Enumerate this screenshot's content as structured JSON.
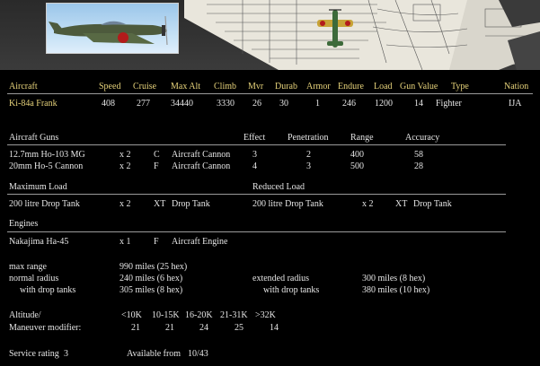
{
  "colors": {
    "header": "#e6d27a",
    "text": "#e6e6e6",
    "background": "#000000",
    "rule": "#9a9a9a"
  },
  "banner": {
    "photo_icon": "aircraft-photo-icon",
    "plane_icon": "aircraft-top-view-icon"
  },
  "summary": {
    "headers": [
      "Aircraft",
      "Speed",
      "Cruise",
      "Max Alt",
      "Climb",
      "Mvr",
      "Durab",
      "Armor",
      "Endure",
      "Load",
      "Gun Value",
      "Type",
      "Nation"
    ],
    "row": {
      "aircraft": "Ki-84a Frank",
      "speed": "408",
      "cruise": "277",
      "max_alt": "34440",
      "climb": "3330",
      "mvr": "26",
      "durab": "30",
      "armor": "1",
      "endure": "246",
      "load": "1200",
      "gun_value": "14",
      "type": "Fighter",
      "nation": "IJA"
    }
  },
  "guns": {
    "title": "Aircraft Guns",
    "headers": {
      "effect": "Effect",
      "penetration": "Penetration",
      "range": "Range",
      "accuracy": "Accuracy"
    },
    "rows": [
      {
        "name": "12.7mm Ho-103 MG",
        "count": "x 2",
        "facing": "C",
        "kind": "Aircraft Cannon",
        "effect": "3",
        "penetration": "2",
        "range": "400",
        "accuracy": "58"
      },
      {
        "name": "20mm Ho-5 Cannon",
        "count": "x 2",
        "facing": "F",
        "kind": "Aircraft Cannon",
        "effect": "4",
        "penetration": "3",
        "range": "500",
        "accuracy": "28"
      }
    ]
  },
  "loads": {
    "max_title": "Maximum Load",
    "reduced_title": "Reduced Load",
    "max": {
      "name": "200 litre Drop Tank",
      "count": "x 2",
      "facing": "XT",
      "kind": "Drop Tank"
    },
    "reduced": {
      "name": "200 litre Drop Tank",
      "count": "x 2",
      "facing": "XT",
      "kind": "Drop Tank"
    }
  },
  "engines": {
    "title": "Engines",
    "row": {
      "name": "Nakajima Ha-45",
      "count": "x 1",
      "facing": "F",
      "kind": "Aircraft Engine"
    }
  },
  "ranges": {
    "max_range_label": "max range",
    "max_range": "990 miles (25 hex)",
    "normal_radius_label": "normal radius",
    "normal_radius": "240 miles (6 hex)",
    "with_drop_tanks_label": "with drop tanks",
    "normal_with_tanks": "305 miles (8 hex)",
    "extended_radius_label": "extended radius",
    "extended_radius": "300 miles (8 hex)",
    "extended_with_drop_tanks_label": "with drop tanks",
    "extended_with_tanks": "380 miles (10 hex)"
  },
  "altitude": {
    "label": "Altitude/",
    "mod_label": "Maneuver modifier:",
    "bands": [
      "<10K",
      "10-15K",
      "16-20K",
      "21-31K",
      ">32K"
    ],
    "modifiers": [
      "21",
      "21",
      "24",
      "25",
      "14"
    ]
  },
  "service": {
    "label": "Service rating",
    "rating": "3",
    "available_label": "Available from",
    "available": "10/43"
  }
}
